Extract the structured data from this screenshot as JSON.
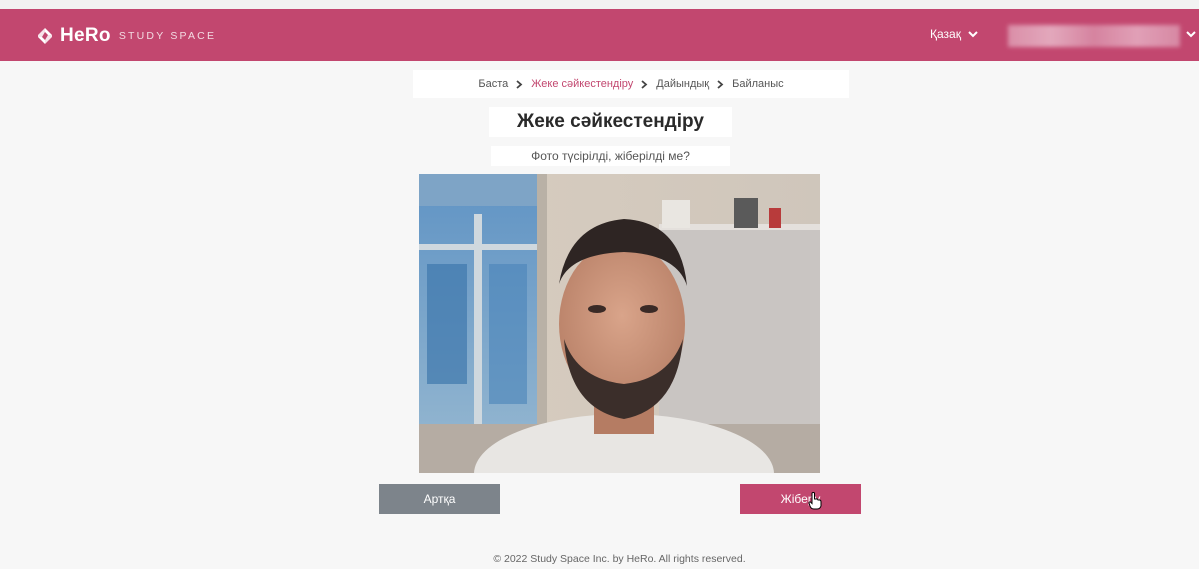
{
  "header": {
    "brand": "HeRo",
    "brand_sub": "STUDY SPACE",
    "language": "Қазақ",
    "accent_color": "#c2476f"
  },
  "breadcrumb": {
    "items": [
      "Баста",
      "Жеке сәйкестендіру",
      "Дайындық",
      "Байланыс"
    ],
    "active_index": 1
  },
  "page": {
    "title": "Жеке сәйкестендіру",
    "subtitle": "Фото түсірілді, жіберілді ме?"
  },
  "buttons": {
    "back": "Артқа",
    "send": "Жіберу"
  },
  "footer": {
    "text": "© 2022 Study Space Inc. by HeRo. All rights reserved."
  },
  "icons": [
    "hero-logo-icon",
    "chevron-down-icon",
    "chevron-right-icon",
    "hand-pointer-icon"
  ]
}
